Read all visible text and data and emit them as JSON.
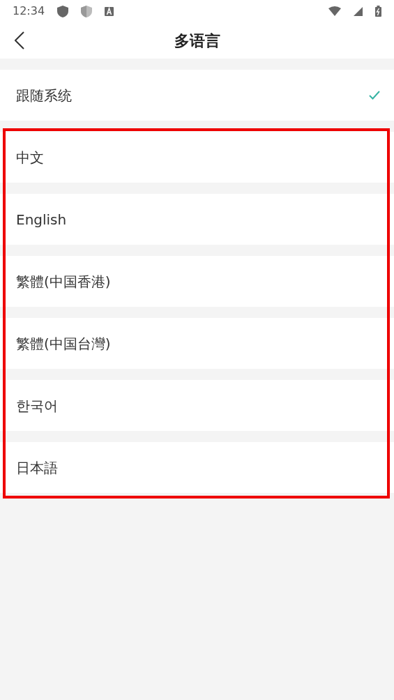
{
  "status_bar": {
    "time": "12:34"
  },
  "header": {
    "title": "多语言"
  },
  "languages": [
    {
      "label": "跟随系统",
      "selected": true
    },
    {
      "label": "中文",
      "selected": false
    },
    {
      "label": "English",
      "selected": false
    },
    {
      "label": "繁體(中国香港)",
      "selected": false
    },
    {
      "label": "繁體(中国台灣)",
      "selected": false
    },
    {
      "label": "한국어",
      "selected": false
    },
    {
      "label": "日本語",
      "selected": false
    }
  ]
}
